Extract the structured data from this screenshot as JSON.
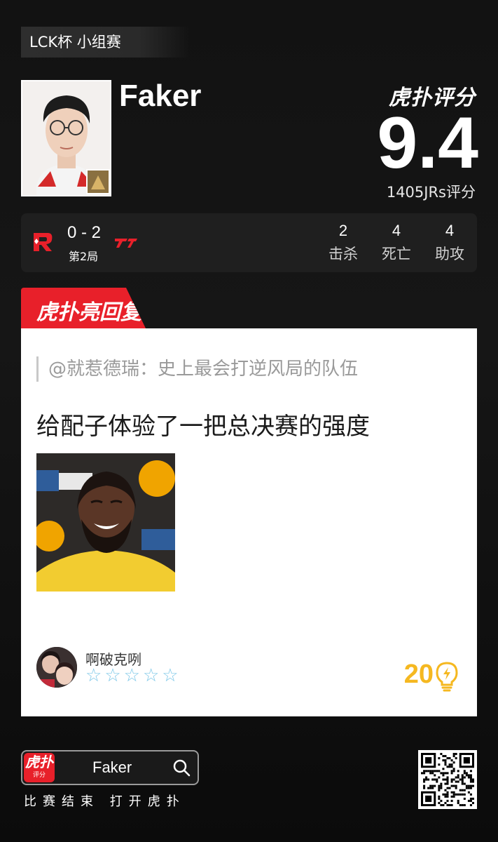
{
  "league": "LCK杯 小组赛",
  "player": {
    "name": "Faker"
  },
  "rating": {
    "brand": "虎扑评分",
    "score": "9.4",
    "count_label": "1405JRs评分"
  },
  "match": {
    "score": "0 - 2",
    "game": "第2局",
    "stats": [
      {
        "value": "2",
        "label": "击杀"
      },
      {
        "value": "4",
        "label": "死亡"
      },
      {
        "value": "4",
        "label": "助攻"
      }
    ]
  },
  "hot_reply": {
    "banner": "虎扑亮回复",
    "quote": "@就惹德瑞：史上最会打逆风局的队伍",
    "text": "给配子体验了一把总决赛的强度",
    "username": "啊破克咧",
    "stars_filled": 0,
    "stars_total": 5,
    "likes": "20"
  },
  "footer": {
    "app_icon_main": "虎扑",
    "app_icon_sub": "评分",
    "search_text": "Faker",
    "hint": "比赛结束 打开虎扑"
  },
  "colors": {
    "accent_red": "#e8202a",
    "like_gold": "#f5b820",
    "star_blue": "#7ec8e8"
  },
  "icons": [
    "search-icon",
    "lightbulb-icon",
    "star-icon",
    "team-logo-kt",
    "team-logo-t1",
    "qr-code"
  ]
}
